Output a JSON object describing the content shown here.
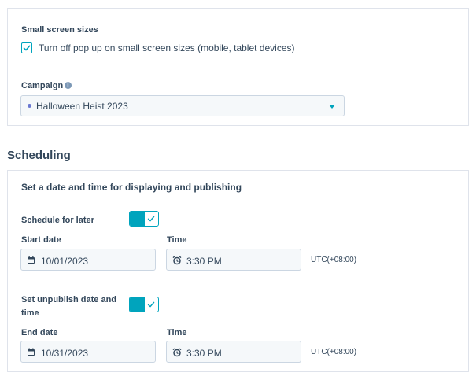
{
  "display": {
    "small_screen_title": "Small screen sizes",
    "small_screen_checkbox_label": "Turn off pop up on small screen sizes (mobile, tablet devices)",
    "small_screen_checked": true,
    "campaign_label": "Campaign",
    "campaign_info_icon": "info-icon",
    "campaign_value": "Halloween Heist 2023"
  },
  "scheduling": {
    "heading": "Scheduling",
    "subheading": "Set a date and time for displaying and publishing",
    "schedule_later_label": "Schedule for later",
    "schedule_later_on": true,
    "start_date_label": "Start date",
    "start_date_value": "10/01/2023",
    "start_time_label": "Time",
    "start_time_value": "3:30 PM",
    "start_timezone": "UTC(+08:00)",
    "unpublish_label_line1": "Set unpublish date and",
    "unpublish_label_line2": "time",
    "unpublish_on": true,
    "end_date_label": "End date",
    "end_date_value": "10/31/2023",
    "end_time_label": "Time",
    "end_time_value": "3:30 PM",
    "end_timezone": "UTC(+08:00)"
  },
  "colors": {
    "accent": "#00a4bd",
    "text": "#33475b",
    "field_bg": "#f5f8fa",
    "border": "#cbd6e2",
    "campaign_dot": "#6a78d1"
  }
}
